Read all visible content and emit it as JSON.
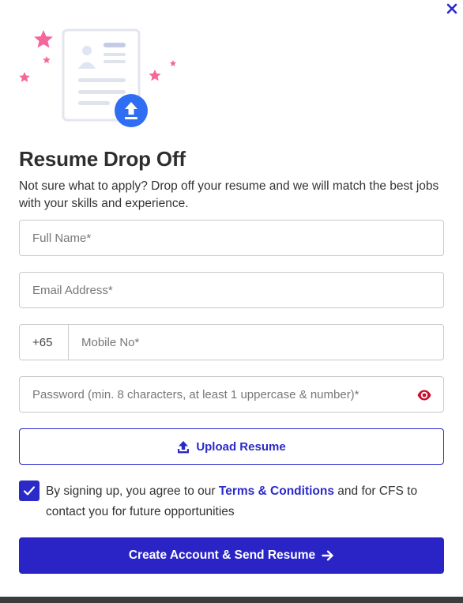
{
  "colors": {
    "accent": "#2a2ac9",
    "submit_bg": "#2a24c6",
    "star_pink": "#f4679a",
    "upload_badge": "#2f6df2",
    "eye_red": "#c8102e"
  },
  "header": {
    "close_icon": "close-icon",
    "title": "Resume Drop Off",
    "subtitle": "Not sure what to apply? Drop off your resume and we will match the best jobs with your skills and experience."
  },
  "form": {
    "full_name": {
      "placeholder": "Full Name*",
      "value": ""
    },
    "email": {
      "placeholder": "Email Address*",
      "value": ""
    },
    "phone": {
      "prefix": "+65",
      "placeholder": "Mobile No*",
      "value": ""
    },
    "password": {
      "placeholder": "Password (min. 8 characters, at least 1 uppercase & number)*",
      "value": "",
      "toggle_icon": "eye-icon"
    },
    "upload": {
      "label": "Upload Resume",
      "icon": "upload-icon"
    },
    "consent": {
      "checked": true,
      "text_before": "By signing up, you agree to our ",
      "link_text": "Terms & Conditions",
      "text_after": " and for CFS to contact you for future opportunities"
    },
    "submit": {
      "label": "Create Account & Send Resume",
      "icon": "arrow-right-icon"
    }
  }
}
